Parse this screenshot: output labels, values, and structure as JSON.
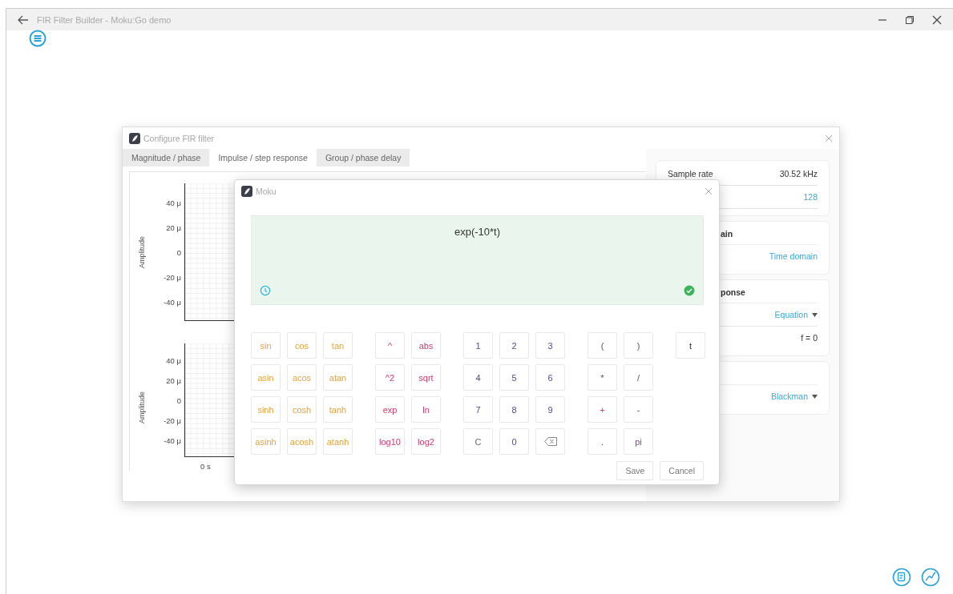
{
  "window": {
    "title": "FIR Filter Builder - Moku:Go demo"
  },
  "fir_dialog": {
    "title": "Configure FIR filter",
    "tabs": [
      {
        "label": "Magnitude / phase",
        "selected": false
      },
      {
        "label": "Impulse / step response",
        "selected": true
      },
      {
        "label": "Group / phase delay",
        "selected": false
      }
    ],
    "plots": [
      {
        "ylabel": "Amplitude",
        "yticks": [
          "40 μ",
          "20 μ",
          "0",
          "-20 μ",
          "-40 μ"
        ]
      },
      {
        "ylabel": "Amplitude",
        "yticks": [
          "40 μ",
          "20 μ",
          "0",
          "-20 μ",
          "-40 μ"
        ],
        "xticks": [
          "0 s"
        ]
      }
    ],
    "settings": [
      {
        "rows": [
          {
            "kind": "plain",
            "label": "Sample rate",
            "value": "30.52 kHz"
          },
          {
            "kind": "link",
            "value": "128"
          }
        ]
      },
      {
        "heading": "ain",
        "rows": [
          {
            "kind": "link",
            "value": "Time domain"
          }
        ]
      },
      {
        "heading": "ponse",
        "rows": [
          {
            "kind": "dropdown",
            "value": "Equation"
          },
          {
            "kind": "plain",
            "value": "f = 0"
          }
        ]
      },
      {
        "rows": [
          {
            "kind": "dropdown",
            "value": "Blackman"
          }
        ]
      }
    ]
  },
  "equation_dialog": {
    "title": "Moku",
    "expression": "exp(-10*t)",
    "valid": true,
    "keypad": [
      {
        "keys": [
          {
            "kind": "trig",
            "label": "sin"
          },
          {
            "kind": "trig",
            "label": "cos"
          },
          {
            "kind": "trig",
            "label": "tan"
          },
          {
            "kind": "trig",
            "label": "asin"
          },
          {
            "kind": "trig",
            "label": "acos"
          },
          {
            "kind": "trig",
            "label": "atan"
          },
          {
            "kind": "trig",
            "label": "sinh"
          },
          {
            "kind": "trig",
            "label": "cosh"
          },
          {
            "kind": "trig",
            "label": "tanh"
          },
          {
            "kind": "trig",
            "label": "asinh"
          },
          {
            "kind": "trig",
            "label": "acosh"
          },
          {
            "kind": "trig",
            "label": "atanh"
          }
        ]
      },
      {
        "keys": [
          {
            "kind": "func",
            "label": "^"
          },
          {
            "kind": "func",
            "label": "abs"
          },
          {
            "kind": "func",
            "label": "^2"
          },
          {
            "kind": "func",
            "label": "sqrt"
          },
          {
            "kind": "func",
            "label": "exp"
          },
          {
            "kind": "func",
            "label": "ln"
          },
          {
            "kind": "func",
            "label": "log10"
          },
          {
            "kind": "func",
            "label": "log2"
          }
        ]
      },
      {
        "keys": [
          {
            "kind": "digit",
            "label": "1"
          },
          {
            "kind": "digit",
            "label": "2"
          },
          {
            "kind": "digit",
            "label": "3"
          },
          {
            "kind": "digit",
            "label": "4"
          },
          {
            "kind": "digit",
            "label": "5"
          },
          {
            "kind": "digit",
            "label": "6"
          },
          {
            "kind": "digit",
            "label": "7"
          },
          {
            "kind": "digit",
            "label": "8"
          },
          {
            "kind": "digit",
            "label": "9"
          },
          {
            "kind": "clear",
            "label": "C"
          },
          {
            "kind": "digit",
            "label": "0"
          },
          {
            "kind": "backspace"
          }
        ]
      },
      {
        "keys": [
          {
            "kind": "op",
            "label": "("
          },
          {
            "kind": "op",
            "label": ")"
          },
          {
            "kind": "op",
            "label": "*"
          },
          {
            "kind": "op",
            "label": "/"
          },
          {
            "kind": "plus",
            "label": "+"
          },
          {
            "kind": "op",
            "label": "-"
          },
          {
            "kind": "op",
            "label": "."
          },
          {
            "kind": "const",
            "label": "pi"
          }
        ]
      },
      {
        "keys": [
          {
            "kind": "var",
            "label": "t"
          }
        ]
      }
    ],
    "buttons": [
      "Save",
      "Cancel"
    ]
  }
}
